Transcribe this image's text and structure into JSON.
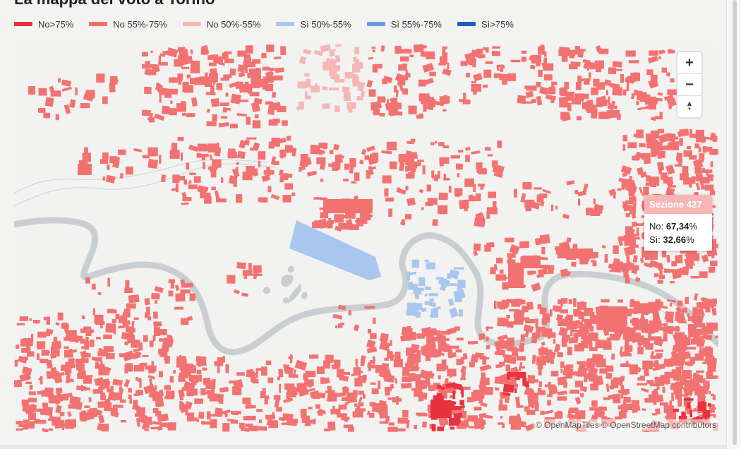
{
  "title": "La mappa del voto a Torino",
  "legend": [
    {
      "label": "No>75%",
      "color": "#e8323e"
    },
    {
      "label": "No 55%-75%",
      "color": "#f27272"
    },
    {
      "label": "No 50%-55%",
      "color": "#f7b6b6"
    },
    {
      "label": "Sì 50%-55%",
      "color": "#a9c6ee"
    },
    {
      "label": "Sì 55%-75%",
      "color": "#6b9ce6"
    },
    {
      "label": "Sì>75%",
      "color": "#1c5fc9"
    }
  ],
  "colors": {
    "no_high": "#e8323e",
    "no_mid": "#f27272",
    "no_low": "#f7b6b6",
    "si_low": "#a9c6ee",
    "river": "#c9cfd1",
    "road": "#cfd5d8",
    "background": "#f2f2f0"
  },
  "zoom": {
    "in_label": "+",
    "out_label": "−",
    "compass_icon": "north-arrow-icon"
  },
  "tooltip": {
    "header": "Sezione 427",
    "no_label": "No: ",
    "no_value": "67,34",
    "si_label": "Sì: ",
    "si_value": "32,66",
    "percent": "%"
  },
  "attribution": "© OpenMapTiles © OpenStreetMap contributors"
}
